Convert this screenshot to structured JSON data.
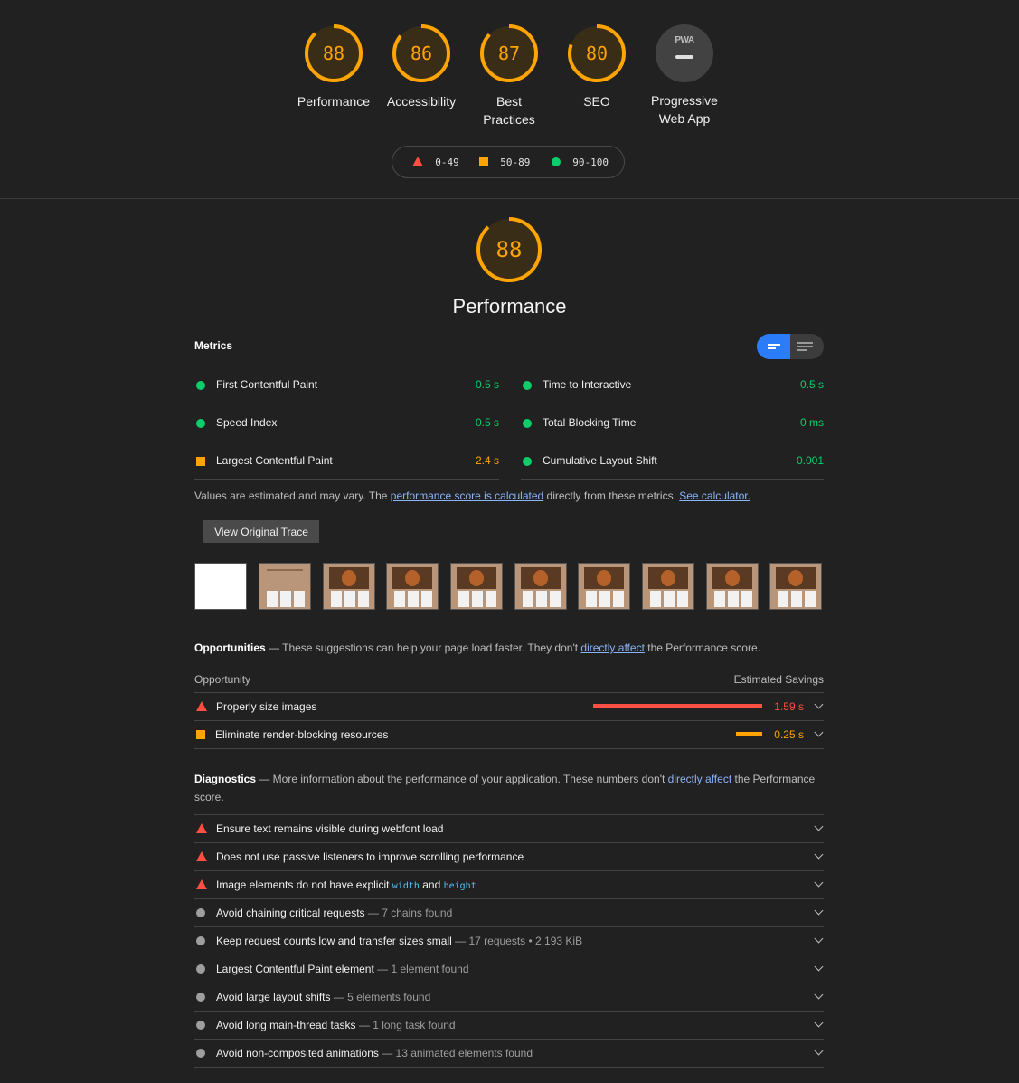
{
  "gauges": [
    {
      "score": "88",
      "label": "Performance",
      "fraction": 0.88
    },
    {
      "score": "86",
      "label": "Accessibility",
      "fraction": 0.86
    },
    {
      "score": "87",
      "label": "Best Practices",
      "fraction": 0.87
    },
    {
      "score": "80",
      "label": "SEO",
      "fraction": 0.8
    },
    {
      "score": "",
      "label": "Progressive Web App",
      "badge": "PWA"
    }
  ],
  "legend": {
    "fail": "0-49",
    "average": "50-89",
    "pass": "90-100"
  },
  "performance": {
    "score": "88",
    "fraction": 0.88,
    "title": "Performance"
  },
  "metrics": {
    "title": "Metrics",
    "left": [
      {
        "name": "First Contentful Paint",
        "value": "0.5 s",
        "rating": "pass"
      },
      {
        "name": "Speed Index",
        "value": "0.5 s",
        "rating": "pass"
      },
      {
        "name": "Largest Contentful Paint",
        "value": "2.4 s",
        "rating": "average"
      }
    ],
    "right": [
      {
        "name": "Time to Interactive",
        "value": "0.5 s",
        "rating": "pass"
      },
      {
        "name": "Total Blocking Time",
        "value": "0 ms",
        "rating": "pass"
      },
      {
        "name": "Cumulative Layout Shift",
        "value": "0.001",
        "rating": "pass"
      }
    ]
  },
  "estimate": {
    "prefix": "Values are estimated and may vary. The ",
    "link1": "performance score is calculated",
    "middle": " directly from these metrics. ",
    "link2": "See calculator."
  },
  "trace_button": "View Original Trace",
  "opportunities": {
    "title": "Opportunities",
    "desc": " — These suggestions can help your page load faster. They don't ",
    "link": "directly affect",
    "suffix": " the Performance score.",
    "col_left": "Opportunity",
    "col_right": "Estimated Savings",
    "items": [
      {
        "title": "Properly size images",
        "savings": "1.59 s",
        "rating": "fail",
        "fraction": 1.0
      },
      {
        "title": "Eliminate render-blocking resources",
        "savings": "0.25 s",
        "rating": "average",
        "fraction": 0.157
      }
    ]
  },
  "diagnostics": {
    "title": "Diagnostics",
    "desc": " — More information about the performance of your application. These numbers don't ",
    "link": "directly affect",
    "suffix": " the Performance score.",
    "items": [
      {
        "title": "Ensure text remains visible during webfont load",
        "sub": "",
        "rating": "fail"
      },
      {
        "title": "Does not use passive listeners to improve scrolling performance",
        "sub": "",
        "rating": "fail"
      },
      {
        "title": "Image elements do not have explicit ",
        "code1": "width",
        "and": " and ",
        "code2": "height",
        "sub": "",
        "rating": "fail"
      },
      {
        "title": "Avoid chaining critical requests",
        "sub": " — 7 chains found",
        "rating": "info"
      },
      {
        "title": "Keep request counts low and transfer sizes small",
        "sub": " — 17 requests • 2,193 KiB",
        "rating": "info"
      },
      {
        "title": "Largest Contentful Paint element",
        "sub": " — 1 element found",
        "rating": "info"
      },
      {
        "title": "Avoid large layout shifts",
        "sub": " — 5 elements found",
        "rating": "info"
      },
      {
        "title": "Avoid long main-thread tasks",
        "sub": " — 1 long task found",
        "rating": "info"
      },
      {
        "title": "Avoid non-composited animations",
        "sub": " — 13 animated elements found",
        "rating": "info"
      }
    ]
  },
  "colors": {
    "pass": "#0cce6b",
    "average": "#ffa400",
    "fail": "#ff4e42",
    "info": "#9e9e9e",
    "toggle_active": "#2a7cf8"
  }
}
